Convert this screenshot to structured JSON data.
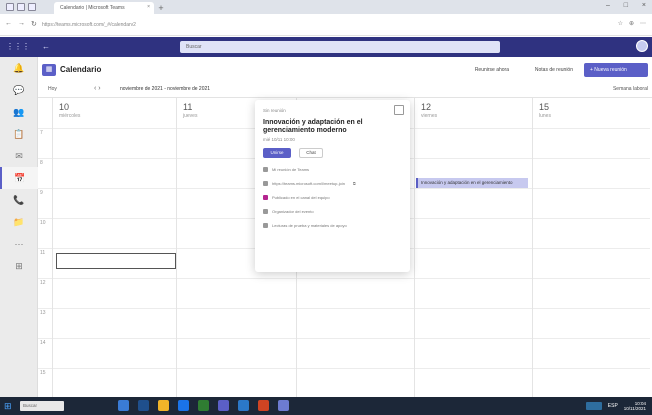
{
  "browser": {
    "tab_title": "Calendario | Microsoft Teams",
    "tab_close": "×",
    "new_tab": "+",
    "url": "https://teams.microsoft.com/_#/calendarv2",
    "window_controls": [
      "–",
      "□",
      "×"
    ],
    "nav_icons": [
      "←",
      "→",
      "↻"
    ],
    "toolbar_icons": [
      "☆",
      "⊕",
      "⋯"
    ]
  },
  "teams": {
    "left_icons": [
      "⋮⋮⋮",
      "←"
    ],
    "search_placeholder": "Buscar"
  },
  "rail": {
    "items": [
      {
        "icon": "bell-icon",
        "glyph": "🔔"
      },
      {
        "icon": "chat-icon",
        "glyph": "💬"
      },
      {
        "icon": "teams-icon",
        "glyph": "👥"
      },
      {
        "icon": "assignments-icon",
        "glyph": "📋"
      },
      {
        "icon": "activity-icon",
        "glyph": "✉"
      },
      {
        "icon": "calendar-icon",
        "glyph": "📅",
        "active": true
      },
      {
        "icon": "calls-icon",
        "glyph": "📞"
      },
      {
        "icon": "files-icon",
        "glyph": "📁"
      },
      {
        "icon": "more-icon",
        "glyph": "⋯"
      },
      {
        "icon": "apps-icon",
        "glyph": "⊞"
      }
    ],
    "help_glyph": "?"
  },
  "calendar": {
    "icon_glyph": "▦",
    "title": "Calendario",
    "meet_now": "Reunirse ahora",
    "meeting_notes": "Notas de reunión",
    "new_meeting": "+ Nueva reunión",
    "today": "Hoy",
    "nav_arrows": "‹ ›",
    "date_range": "noviembre de 2021 - noviembre de 2021",
    "work_week": "Semana laboral",
    "days": [
      {
        "num": "10",
        "name": "miércoles"
      },
      {
        "num": "11",
        "name": "jueves"
      },
      {
        "num": "",
        "name": ""
      },
      {
        "num": "12",
        "name": "viernes"
      },
      {
        "num": "15",
        "name": "lunes"
      }
    ],
    "hours": [
      "7",
      "8",
      "9",
      "10",
      "11",
      "12",
      "13",
      "14",
      "15",
      "16"
    ],
    "event_label": "Innovación y adaptación en el gerenciamiento"
  },
  "popup": {
    "label": "Sin reunión",
    "title": "Innovación y adaptación en el gerenciamiento moderno",
    "time": "mié 10/11 10:00",
    "join": "Unirse",
    "chat": "Chat",
    "rows": [
      {
        "icon": "people-icon",
        "text": "Mi reunión de Teams"
      },
      {
        "icon": "link-icon",
        "text": "https://teams.microsoft.com/l/meetup-join",
        "extra": "⧉"
      },
      {
        "icon": "channel-icon",
        "text": "Publicado en el canal del equipo",
        "pink": true
      },
      {
        "icon": "person-icon",
        "text": "Organizador del evento"
      },
      {
        "icon": "info-icon",
        "text": "Lecturas de prueba y materiales de apoyo"
      }
    ]
  },
  "taskbar": {
    "start_glyph": "⊞",
    "search": "Buscar",
    "apps": [
      {
        "color": "#3a7bd5"
      },
      {
        "color": "#1f4f8c"
      },
      {
        "color": "#f0b429"
      },
      {
        "color": "#1a73e8"
      },
      {
        "color": "#2f7d32"
      },
      {
        "color": "#5b5fc7"
      },
      {
        "color": "#2b78c8"
      },
      {
        "color": "#d04423"
      },
      {
        "color": "#6d7bd1"
      }
    ],
    "tray_text": "ESP",
    "time": "10:04",
    "date": "10/11/2021"
  }
}
